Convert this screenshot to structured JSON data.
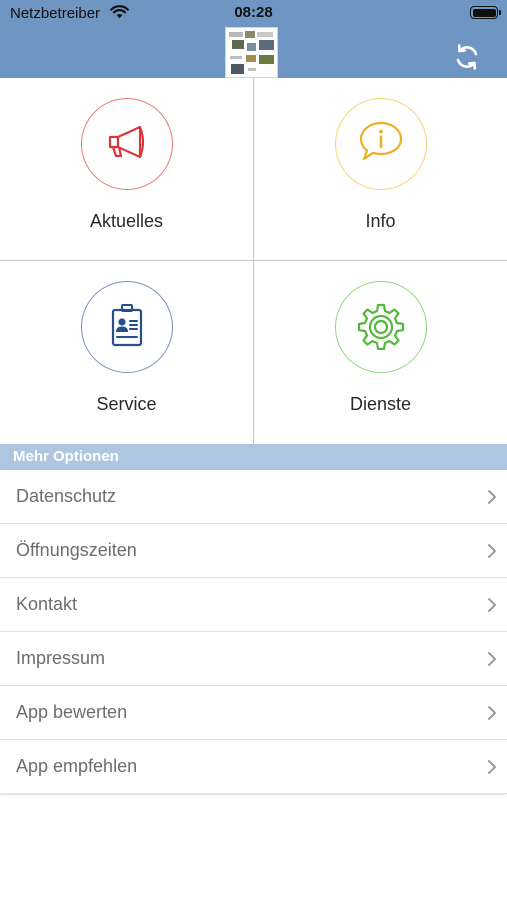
{
  "status_bar": {
    "carrier": "Netzbetreiber",
    "time": "08:28",
    "icons": [
      "wifi-icon",
      "battery-icon"
    ]
  },
  "header": {
    "background": "#6f96c3",
    "logo": "app-logo",
    "refresh_icon": "refresh-icon"
  },
  "tiles": [
    {
      "label": "Aktuelles",
      "icon": "megaphone-icon",
      "color": "#e04b4b"
    },
    {
      "label": "Info",
      "icon": "info-bubble-icon",
      "color": "#f2c12e"
    },
    {
      "label": "Service",
      "icon": "id-badge-icon",
      "color": "#2f5a97"
    },
    {
      "label": "Dienste",
      "icon": "gear-icon",
      "color": "#63c34a"
    }
  ],
  "more_options": {
    "title": "Mehr Optionen",
    "items": [
      {
        "label": "Datenschutz"
      },
      {
        "label": "Öffnungszeiten"
      },
      {
        "label": "Kontakt"
      },
      {
        "label": "Impressum"
      },
      {
        "label": "App bewerten"
      },
      {
        "label": "App empfehlen"
      }
    ]
  }
}
